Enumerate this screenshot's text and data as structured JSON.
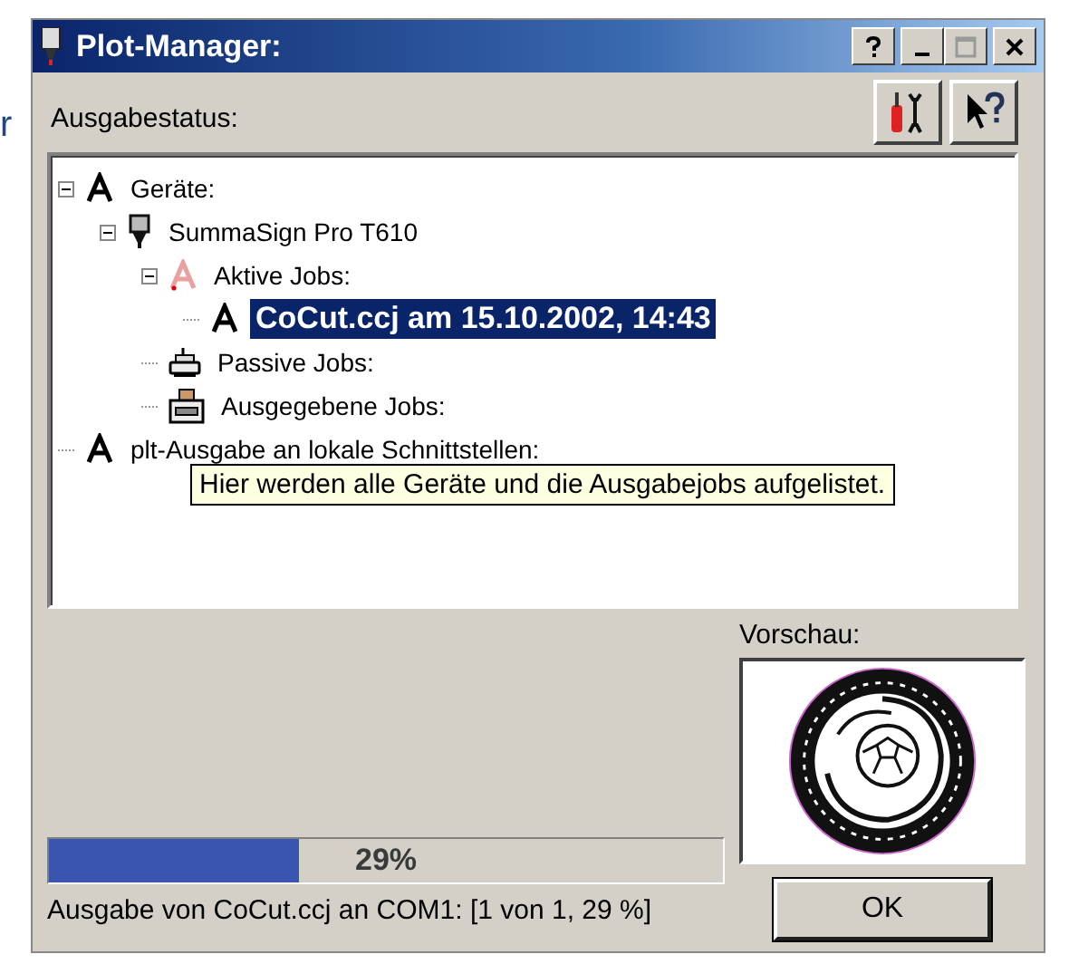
{
  "background_text": "r",
  "window": {
    "title": "Plot-Manager:"
  },
  "status_label": "Ausgabestatus:",
  "tree": [
    {
      "label": "Geräte:",
      "kind": "font",
      "selected": false,
      "expanded": true,
      "children": [
        {
          "label": "SummaSign Pro T610",
          "kind": "plotter",
          "selected": false,
          "expanded": true,
          "children": [
            {
              "label": "Aktive Jobs:",
              "kind": "font-faded",
              "selected": false,
              "expanded": true,
              "children": [
                {
                  "label": "CoCut.ccj am 15.10.2002, 14:43",
                  "kind": "font",
                  "selected": true
                }
              ]
            },
            {
              "label": "Passive Jobs:",
              "kind": "printer",
              "selected": false
            },
            {
              "label": "Ausgegebene Jobs:",
              "kind": "printer-output",
              "selected": false
            }
          ]
        }
      ]
    },
    {
      "label": "plt-Ausgabe an lokale Schnittstellen:",
      "kind": "font",
      "selected": false
    }
  ],
  "tooltip": "Hier werden alle Geräte und die Ausgabejobs aufgelistet.",
  "preview_label": "Vorschau:",
  "progress": {
    "level": 0.37,
    "text": "29%"
  },
  "status_text": "Ausgabe von CoCut.ccj an COM1: [1 von 1, 29 %]",
  "ok_button": "OK"
}
